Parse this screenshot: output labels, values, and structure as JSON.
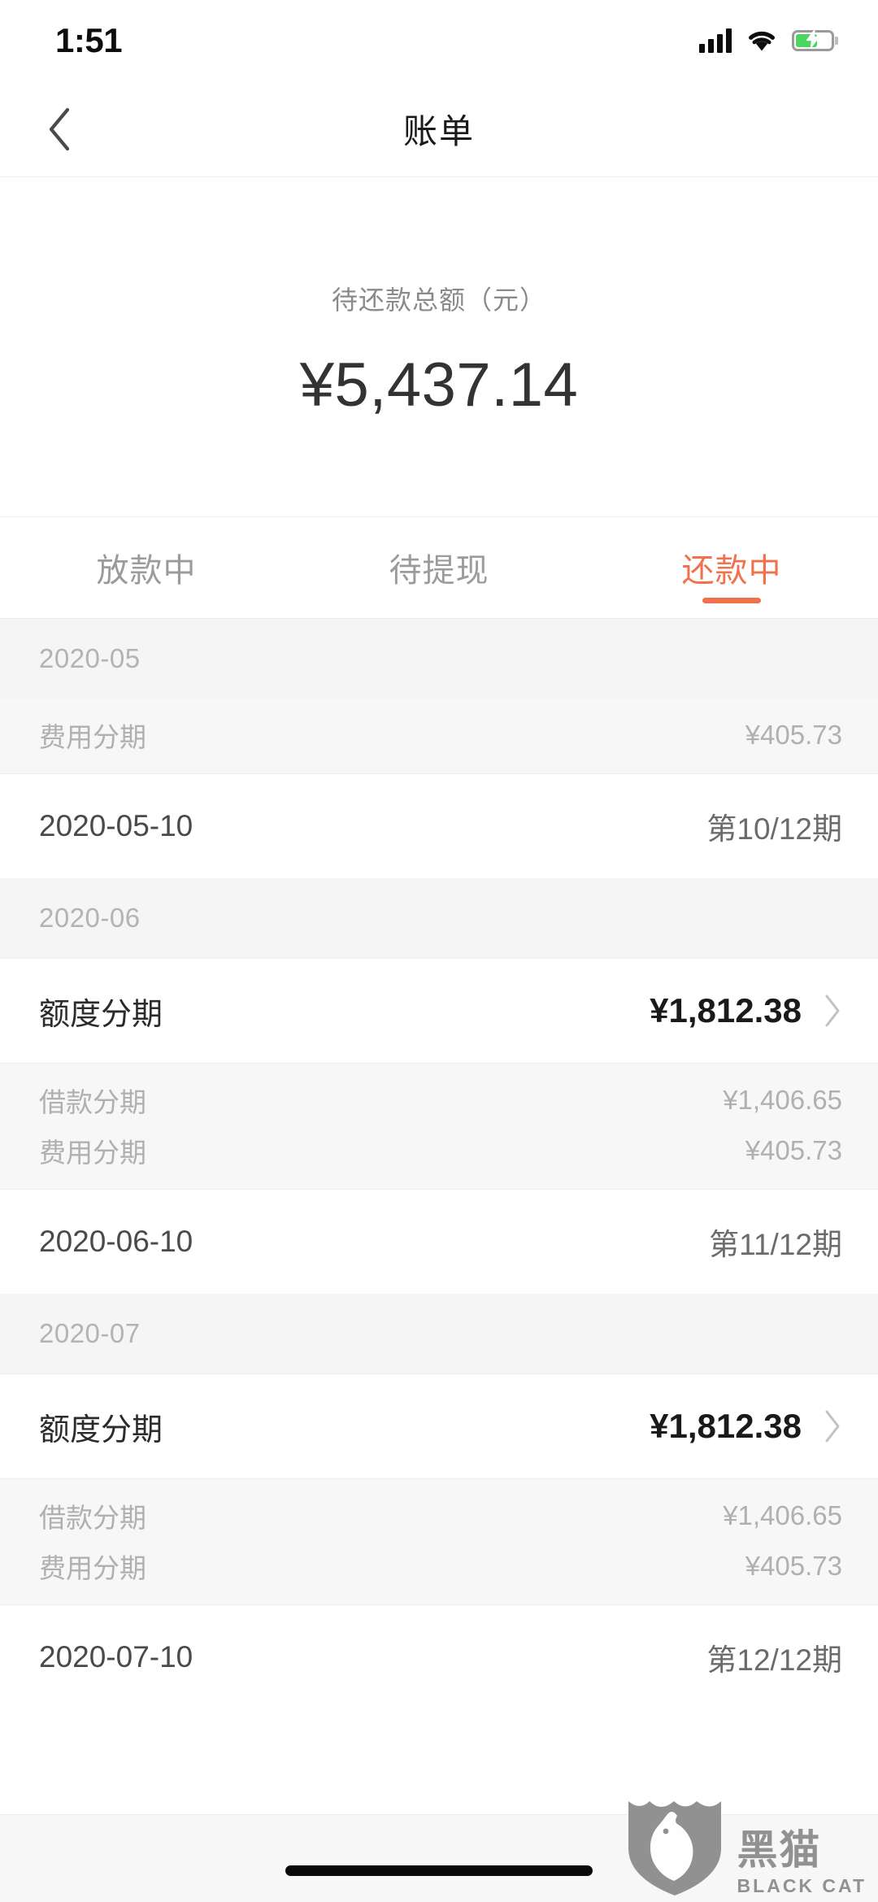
{
  "status_bar": {
    "time": "1:51",
    "signal_icon": "cellular-signal-icon",
    "wifi_icon": "wifi-icon",
    "battery_icon": "battery-charging-icon"
  },
  "nav": {
    "back_icon": "chevron-left-icon",
    "title": "账单"
  },
  "summary": {
    "label": "待还款总额（元）",
    "amount": "¥5,437.14"
  },
  "tabs": [
    {
      "label": "放款中",
      "active": false
    },
    {
      "label": "待提现",
      "active": false
    },
    {
      "label": "还款中",
      "active": true
    }
  ],
  "colors": {
    "accent": "#f2714d",
    "text_primary": "#1a1a1a",
    "text_muted": "#b0b0b0",
    "group_header_bg": "#f5f5f5",
    "sub_block_bg": "#f7f7f7"
  },
  "groups": [
    {
      "month": "2020-05",
      "main_row": null,
      "sub_rows": [
        {
          "label": "费用分期",
          "value": "¥405.73"
        }
      ],
      "date_row": {
        "date": "2020-05-10",
        "period": "第10/12期"
      }
    },
    {
      "month": "2020-06",
      "main_row": {
        "label": "额度分期",
        "value": "¥1,812.38",
        "chevron_icon": "chevron-right-icon"
      },
      "sub_rows": [
        {
          "label": "借款分期",
          "value": "¥1,406.65"
        },
        {
          "label": "费用分期",
          "value": "¥405.73"
        }
      ],
      "date_row": {
        "date": "2020-06-10",
        "period": "第11/12期"
      }
    },
    {
      "month": "2020-07",
      "main_row": {
        "label": "额度分期",
        "value": "¥1,812.38",
        "chevron_icon": "chevron-right-icon"
      },
      "sub_rows": [
        {
          "label": "借款分期",
          "value": "¥1,406.65"
        },
        {
          "label": "费用分期",
          "value": "¥405.73"
        }
      ],
      "date_row": {
        "date": "2020-07-10",
        "period": "第12/12期"
      }
    }
  ],
  "watermark": {
    "logo_icon": "black-cat-shield-logo",
    "name_cn": "黑猫",
    "name_en": "BLACK CAT"
  }
}
